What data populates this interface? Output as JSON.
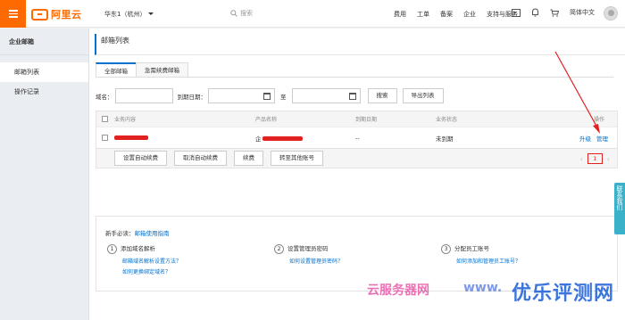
{
  "topbar": {
    "logo": "阿里云",
    "region": "华东1（杭州）",
    "search_placeholder": "搜索",
    "nav": [
      "费用",
      "工单",
      "备案",
      "企业",
      "支持与服务"
    ],
    "lang": "简体中文",
    "icons": [
      "terminal-icon",
      "bell-icon",
      "cart-icon"
    ]
  },
  "sidebar": {
    "title": "企业邮箱",
    "items": [
      {
        "label": "邮箱列表",
        "active": true
      },
      {
        "label": "操作记录",
        "active": false
      }
    ]
  },
  "page": {
    "title": "邮箱列表"
  },
  "tabs": [
    {
      "label": "全部邮箱",
      "active": true
    },
    {
      "label": "急需续费邮箱",
      "active": false
    }
  ],
  "filters": {
    "domain_label": "域名：",
    "expire_label": "到期日期：",
    "to_label": "至",
    "search_button": "搜索",
    "export_button": "导出列表"
  },
  "table": {
    "headers": [
      "业务内容",
      "产品名称",
      "到期日期",
      "业务状态",
      "操作"
    ],
    "rows": [
      {
        "content": "",
        "product": "企",
        "expire": "--",
        "status": "未到期",
        "actions": [
          "升级",
          "管理"
        ]
      }
    ],
    "footer_buttons": [
      "设置自动续费",
      "取消自动续费",
      "续费",
      "转至其他账号"
    ],
    "page": "1"
  },
  "guide": {
    "title": "新手必读：",
    "title_link": "邮箱使用指南",
    "steps": [
      {
        "num": "1",
        "label": "添加域名解析",
        "links": [
          "邮箱域名解析设置方法？",
          "如何更换绑定域名？"
        ]
      },
      {
        "num": "2",
        "label": "设置管理员密码",
        "links": [
          "如何设置管理员密码？"
        ]
      },
      {
        "num": "3",
        "label": "分配员工账号",
        "links": [
          "如何添加和管理员工账号？"
        ]
      }
    ]
  },
  "contact": "联系我们",
  "watermarks": [
    "云服务器网",
    "www.",
    "优乐评测网"
  ],
  "colors": {
    "brand": "#ff6a00",
    "link": "#0070cc",
    "annotation": "#e12020"
  }
}
